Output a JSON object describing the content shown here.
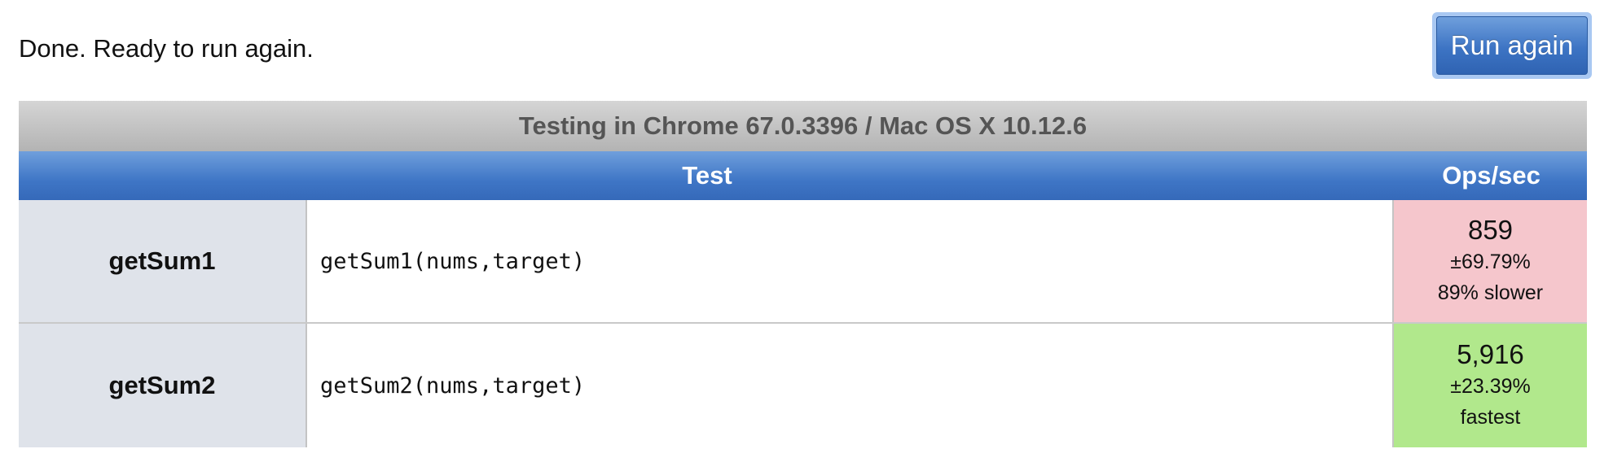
{
  "status": {
    "message": "Done. Ready to run again."
  },
  "toolbar": {
    "run_label": "Run again"
  },
  "results": {
    "caption": "Testing in Chrome 67.0.3396 / Mac OS X 10.12.6",
    "headers": {
      "test": "Test",
      "ops": "Ops/sec"
    },
    "rows": [
      {
        "name": "getSum1",
        "code": "getSum1(nums,target)",
        "ops": "859",
        "rme": "±69.79%",
        "rank": "89% slower",
        "color": "#f5c6cc"
      },
      {
        "name": "getSum2",
        "code": "getSum2(nums,target)",
        "ops": "5,916",
        "rme": "±23.39%",
        "rank": "fastest",
        "color": "#b1e88c"
      }
    ]
  }
}
